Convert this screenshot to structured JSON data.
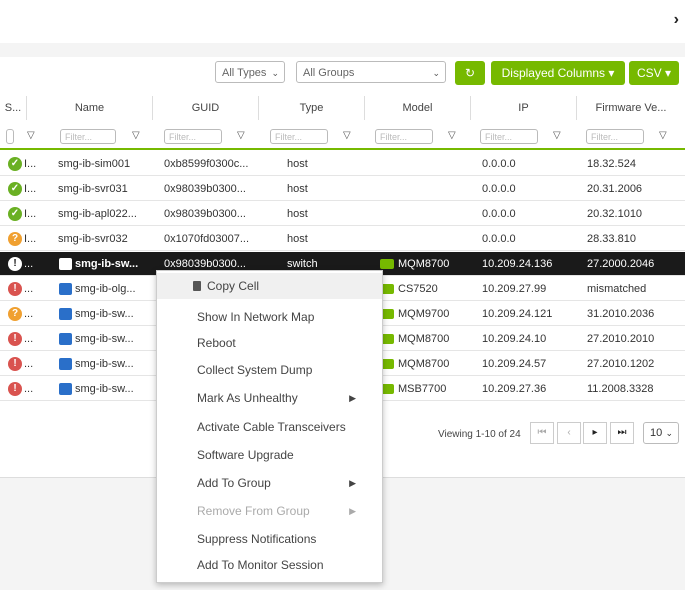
{
  "toolbar": {
    "types_select": "All Types",
    "groups_select": "All Groups",
    "displayed_columns": "Displayed Columns",
    "csv": "CSV"
  },
  "columns": [
    "S...",
    "Name",
    "GUID",
    "Type",
    "Model",
    "IP",
    "Firmware Ve..."
  ],
  "filter_placeholder": "Filter...",
  "rows": [
    {
      "status": "ok",
      "flag": "I...",
      "name": "smg-ib-sim001",
      "guid": "0xb8599f0300c...",
      "type": "host",
      "model": "",
      "ip": "0.0.0.0",
      "fw": "18.32.524"
    },
    {
      "status": "ok",
      "flag": "I...",
      "name": "smg-ib-svr031",
      "guid": "0x98039b0300...",
      "type": "host",
      "model": "",
      "ip": "0.0.0.0",
      "fw": "20.31.2006"
    },
    {
      "status": "ok",
      "flag": "I...",
      "name": "smg-ib-apl022...",
      "guid": "0x98039b0300...",
      "type": "host",
      "model": "",
      "ip": "0.0.0.0",
      "fw": "20.32.1010"
    },
    {
      "status": "warn",
      "flag": "I...",
      "name": "smg-ib-svr032",
      "guid": "0x1070fd03007...",
      "type": "host",
      "model": "",
      "ip": "0.0.0.0",
      "fw": "28.33.810"
    },
    {
      "status": "info",
      "flag": "...",
      "name": "smg-ib-sw...",
      "guid": "0x98039b0300...",
      "type": "switch",
      "model": "MQM8700",
      "ip": "10.209.24.136",
      "fw": "27.2000.2046"
    },
    {
      "status": "err",
      "flag": "...",
      "name": "smg-ib-olg...",
      "guid": "",
      "type": "",
      "model": "CS7520",
      "ip": "10.209.27.99",
      "fw": "mismatched"
    },
    {
      "status": "warn",
      "flag": "...",
      "name": "smg-ib-sw...",
      "guid": "",
      "type": "",
      "model": "MQM9700",
      "ip": "10.209.24.121",
      "fw": "31.2010.2036"
    },
    {
      "status": "err",
      "flag": "...",
      "name": "smg-ib-sw...",
      "guid": "",
      "type": "",
      "model": "MQM8700",
      "ip": "10.209.24.10",
      "fw": "27.2010.2010"
    },
    {
      "status": "err",
      "flag": "...",
      "name": "smg-ib-sw...",
      "guid": "",
      "type": "",
      "model": "MQM8700",
      "ip": "10.209.24.57",
      "fw": "27.2010.1202"
    },
    {
      "status": "err",
      "flag": "...",
      "name": "smg-ib-sw...",
      "guid": "",
      "type": "",
      "model": "MSB7700",
      "ip": "10.209.27.36",
      "fw": "11.2008.3328"
    }
  ],
  "pagination": {
    "viewing": "Viewing 1-10 of 24",
    "page_size": "10"
  },
  "context_menu": [
    {
      "label": "Copy Cell",
      "sub": false,
      "disabled": false
    },
    {
      "label": "Show In Network Map",
      "sub": false,
      "disabled": false
    },
    {
      "label": "Reboot",
      "sub": false,
      "disabled": false
    },
    {
      "label": "Collect System Dump",
      "sub": false,
      "disabled": false
    },
    {
      "label": "Mark As Unhealthy",
      "sub": true,
      "disabled": false
    },
    {
      "label": "Activate Cable Transceivers",
      "sub": false,
      "disabled": false
    },
    {
      "label": "Software Upgrade",
      "sub": false,
      "disabled": false
    },
    {
      "label": "Add To Group",
      "sub": true,
      "disabled": false
    },
    {
      "label": "Remove From Group",
      "sub": true,
      "disabled": true
    },
    {
      "label": "Suppress Notifications",
      "sub": false,
      "disabled": false
    },
    {
      "label": "Add To Monitor Session",
      "sub": false,
      "disabled": false
    }
  ],
  "colors": {
    "accent": "#76b900",
    "selected_row": "#1a1a1a",
    "device_icon": "#2a6fc9"
  }
}
